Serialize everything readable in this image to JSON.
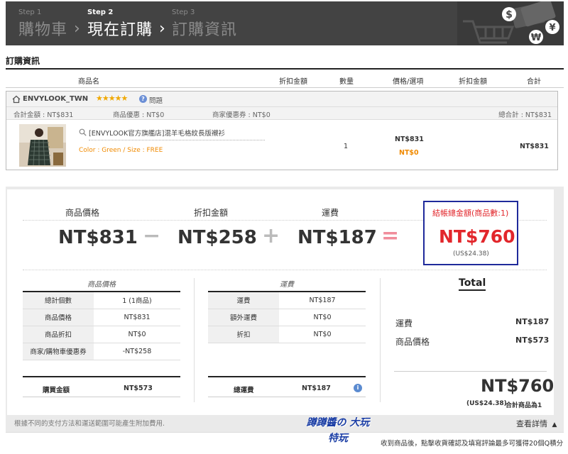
{
  "steps": [
    {
      "num": "Step 1",
      "title": "購物車"
    },
    {
      "num": "Step 2",
      "title": "現在訂購"
    },
    {
      "num": "Step 3",
      "title": "訂購資訊"
    }
  ],
  "section_title": "訂購資訊",
  "table_headers": [
    "商品名",
    "折扣金額",
    "數量",
    "價格/選項",
    "折扣金額",
    "合計"
  ],
  "shop": {
    "name": "ENVYLOOK_TWN",
    "rating_stars": 5,
    "qa_label": "問題",
    "subtotal": "合計金額 : NT$831",
    "product_discount": "商品優惠 : NT$0",
    "shop_coupon": "商家優惠券 : NT$0",
    "total": "總合計 : NT$831"
  },
  "item": {
    "name": "[ENVYLOOK官方旗艦店]混羊毛格紋長版襯衫",
    "option": "Color : Green / Size : FREE",
    "qty": "1",
    "price": "NT$831",
    "price_discount": "NT$0",
    "total": "NT$831"
  },
  "summary": {
    "product_price_label": "商品價格",
    "product_price": "NT$831",
    "discount_label": "折扣金額",
    "discount": "NT$258",
    "shipping_label": "運費",
    "shipping": "NT$187",
    "checkout_label": "結帳總金額(商品數:1)",
    "checkout_total": "NT$760",
    "checkout_usd": "(US$24.38)",
    "op_minus": "−",
    "op_plus": "+",
    "op_equals": "="
  },
  "price_table": {
    "heading": "商品價格",
    "rows": [
      {
        "k": "總計個數",
        "v": "1 (1商品)"
      },
      {
        "k": "商品價格",
        "v": "NT$831"
      },
      {
        "k": "商品折扣",
        "v": "NT$0"
      },
      {
        "k": "商家/購物車優惠券",
        "v": "-NT$258"
      }
    ],
    "footer_k": "購買金額",
    "footer_v": "NT$573"
  },
  "shipping_table": {
    "heading": "運費",
    "rows": [
      {
        "k": "運費",
        "v": "NT$187"
      },
      {
        "k": "額外運費",
        "v": "NT$0"
      },
      {
        "k": "折扣",
        "v": "NT$0"
      }
    ],
    "footer_k": "總運費",
    "footer_v": "NT$187"
  },
  "total_panel": {
    "heading": "Total",
    "rows": [
      {
        "k": "運費",
        "v": "NT$187"
      },
      {
        "k": "商品價格",
        "v": "NT$573"
      }
    ],
    "grand": "NT$760",
    "usd": "(US$24.38)",
    "count": "合計商品為1"
  },
  "notes": {
    "payment": "根據不同的支付方法和運送範圍可能產生附加費用.",
    "details": "查看詳情",
    "review": "收到商品後，點擊收貨確認及填寫評論最多可獲得20個Q積分"
  },
  "watermark": "蹲蹲醬の 大玩特玩",
  "colors": {
    "accent_red": "#e2262b",
    "orange": "#f08a00",
    "box_blue": "#1f2a9b",
    "banner": "#434343"
  }
}
